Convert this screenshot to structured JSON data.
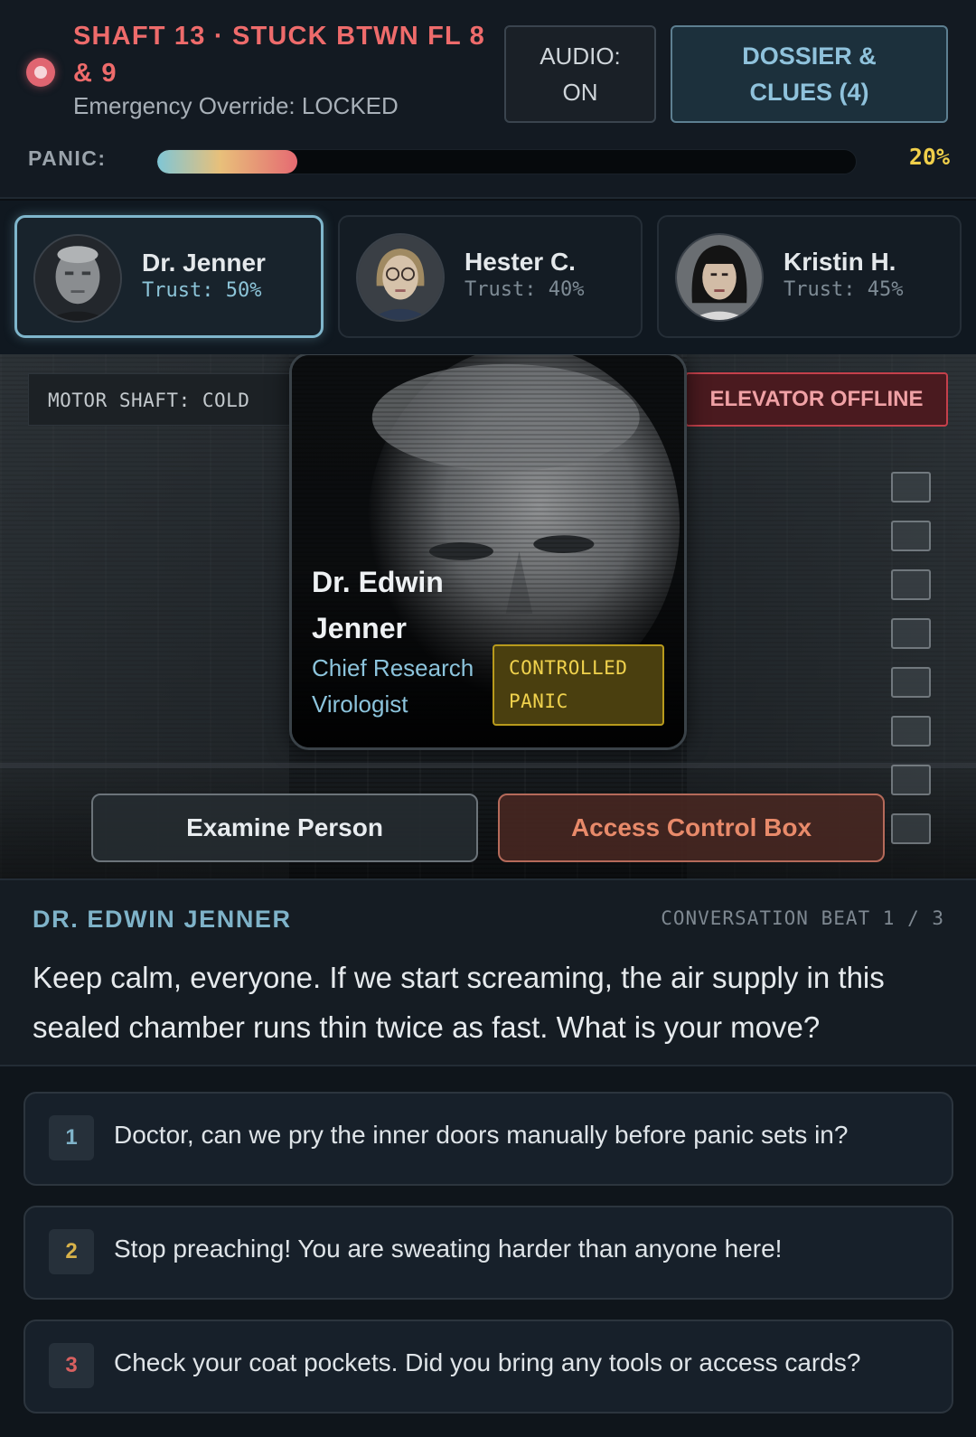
{
  "header": {
    "location": "SHAFT 13 · STUCK BTWN FL 8 & 9",
    "override": "Emergency Override: LOCKED",
    "audio_button": "AUDIO: ON",
    "dossier_button": "DOSSIER & CLUES (4)",
    "panic_label": "PANIC:",
    "panic_value": "20%",
    "panic_fraction": 0.2
  },
  "characters": [
    {
      "name": "Dr. Jenner",
      "trust": "Trust: 50%",
      "active": true
    },
    {
      "name": "Hester C.",
      "trust": "Trust: 40%",
      "active": false
    },
    {
      "name": "Kristin H.",
      "trust": "Trust: 45%",
      "active": false
    }
  ],
  "scene": {
    "motor_tag": "MOTOR SHAFT: COLD",
    "offline_tag": "ELEVATOR OFFLINE",
    "portrait": {
      "name": "Dr. Edwin Jenner",
      "role": "Chief Research Virologist",
      "state": "CONTROLLED PANIC"
    },
    "examine_button": "Examine Person",
    "access_button": "Access Control Box"
  },
  "dialogue": {
    "speaker": "DR. EDWIN JENNER",
    "beat": "CONVERSATION BEAT 1 / 3",
    "line": "Keep calm, everyone. If we start screaming, the air supply in this sealed chamber runs thin twice as fast. What is your move?"
  },
  "choices": [
    {
      "num": "1",
      "text": "Doctor, can we pry the inner doors manually before panic sets in?"
    },
    {
      "num": "2",
      "text": "Stop preaching! You are sweating harder than anyone here!"
    },
    {
      "num": "3",
      "text": "Check your coat pockets. Did you bring any tools or access cards?"
    }
  ],
  "colors": {
    "alert_red": "#ee6b6b",
    "accent_blue": "#7fb6cc",
    "panic_yellow": "#f0cf4a"
  }
}
